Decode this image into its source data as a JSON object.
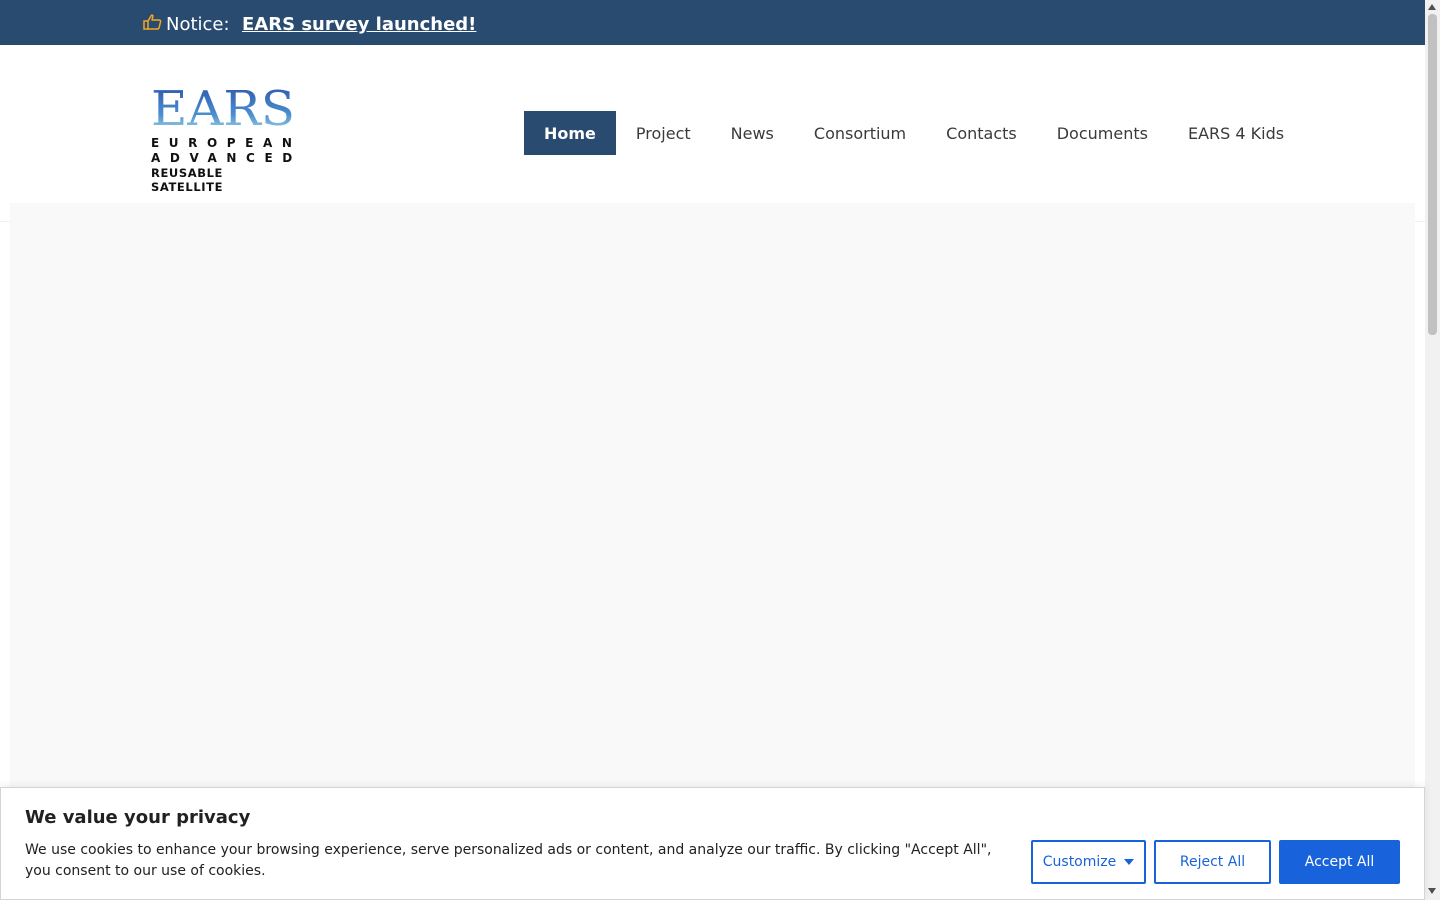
{
  "notice": {
    "icon": "pointing-hand-icon",
    "label": "Notice:",
    "link_text": "EARS survey launched!"
  },
  "logo": {
    "title": "EARS",
    "line1": "EUROPEAN",
    "line2": "ADVANCED",
    "line3": "REUSABLE SATELLITE"
  },
  "nav": {
    "items": [
      {
        "label": "Home",
        "active": true
      },
      {
        "label": "Project",
        "active": false
      },
      {
        "label": "News",
        "active": false
      },
      {
        "label": "Consortium",
        "active": false
      },
      {
        "label": "Contacts",
        "active": false
      },
      {
        "label": "Documents",
        "active": false
      },
      {
        "label": "EARS 4 Kids",
        "active": false
      }
    ]
  },
  "cookie": {
    "title": "We value your privacy",
    "text": "We use cookies to enhance your browsing experience, serve personalized ads or content, and analyze our traffic. By clicking \"Accept All\", you consent to our use of cookies.",
    "customize_label": "Customize",
    "reject_label": "Reject All",
    "accept_label": "Accept All"
  },
  "colors": {
    "brand_navy": "#294b6f",
    "accent_blue": "#1863dc",
    "notice_icon": "#f5a623"
  }
}
